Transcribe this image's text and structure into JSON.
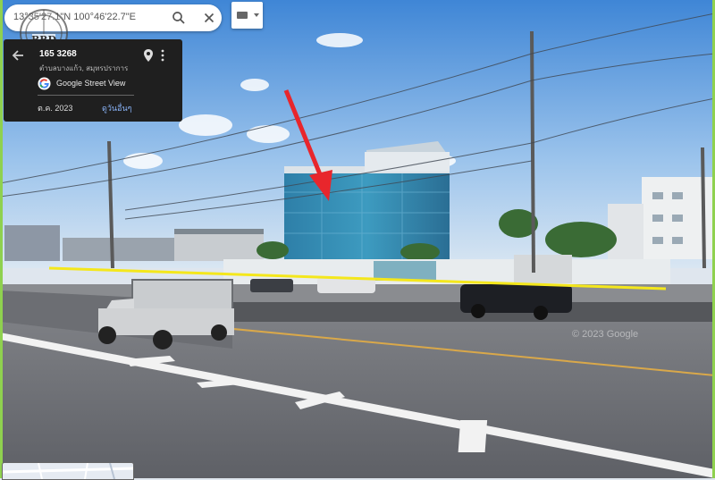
{
  "search": {
    "coordinates": "13°35'27.1\"N 100°46'22.7\"E"
  },
  "logo": {
    "text": "BRD"
  },
  "info_panel": {
    "title": "165 3268",
    "subtitle": "ตำบลบางแก้ว, สมุทรปราการ",
    "source_label": "Google Street View",
    "capture_date": "ต.ค. 2023",
    "see_more_label": "ดูวันอื่นๆ"
  },
  "watermark": "© 2023 Google",
  "icons": {
    "search": "search-icon",
    "close": "close-icon",
    "keyboard": "keyboard-icon",
    "back": "back-arrow-icon",
    "pin": "map-pin-icon",
    "more": "more-vert-icon",
    "arrow": "red-arrow-icon"
  },
  "colors": {
    "panel_background": "#1f1f1f",
    "link": "#8ab4f8",
    "annotation_arrow": "#e8262c",
    "property_line": "#f4e71c",
    "frame_border": "#8fd14f"
  }
}
